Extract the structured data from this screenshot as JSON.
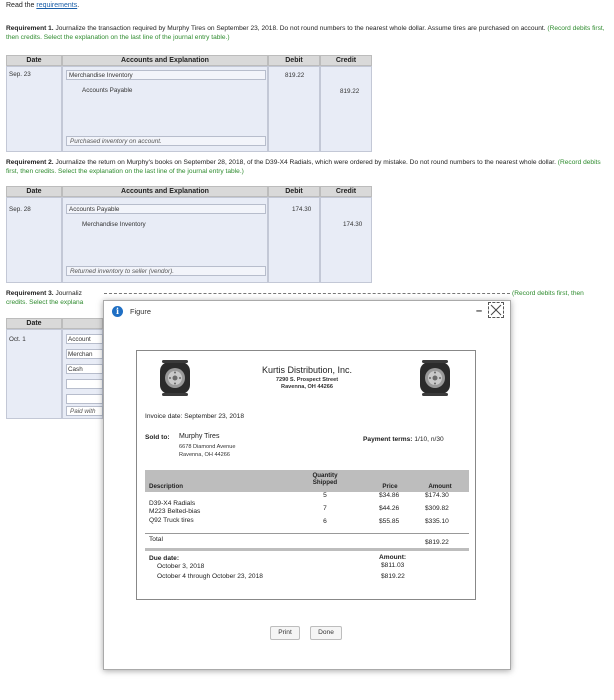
{
  "header": {
    "read_the": "Read the ",
    "requirements_link": "requirements",
    "period": "."
  },
  "req1": {
    "label": "Requirement 1.",
    "text": " Journalize the transaction required by Murphy Tires on September 23, 2018. Do not round numbers to the nearest whole dollar. Assume tires are purchased on account.",
    "hint": "(Record debits first, then credits. Select the explanation on the last line of the journal entry table.)",
    "date": "Sep. 23",
    "line1_account": "Merchandise Inventory",
    "line1_debit": "819.22",
    "line2_account": "Accounts Payable",
    "line2_credit": "819.22",
    "explanation": "Purchased inventory on account."
  },
  "req2": {
    "label": "Requirement 2.",
    "text": " Journalize the return on Murphy's books on September 28, 2018, of the D39-X4 Radials, which were ordered by mistake. Do not round numbers to the nearest whole dollar.",
    "hint": "(Record debits first, then credits. Select the explanation on the last line of the journal entry table.)",
    "date": "Sep. 28",
    "line1_account": "Accounts Payable",
    "line1_debit": "174.30",
    "line2_account": "Merchandise Inventory",
    "line2_credit": "174.30",
    "explanation": "Returned inventory to seller (vendor)."
  },
  "req3": {
    "label": "Requirement 3.",
    "text_visible": " Journaliz",
    "hint_right": "(Record debits first, then",
    "hint_cont": "credits. Select the explana",
    "date": "Oct. 1",
    "acc1": "Account",
    "acc2": "Merchan",
    "acc3": "Cash",
    "explanation": "Paid with"
  },
  "table_headers": {
    "date": "Date",
    "accounts": "Accounts and Explanation",
    "debit": "Debit",
    "credit": "Credit"
  },
  "modal": {
    "info_glyph": "i",
    "title": "Figure",
    "minimize": "–",
    "print_label": "Print",
    "done_label": "Done"
  },
  "invoice": {
    "company": "Kurtis Distribution, Inc.",
    "street": "7290 S. Prospect Street",
    "city": "Ravenna, OH 44266",
    "invoice_date_label": "Invoice date:",
    "invoice_date": "September 23, 2018",
    "sold_to_label": "Sold to:",
    "buyer": "Murphy Tires",
    "buyer_street": "6678 Diamond Avenue",
    "buyer_city": "Ravenna, OH 44266",
    "payment_terms_label": "Payment terms:",
    "payment_terms": "1/10, n/30",
    "col_description": "Description",
    "col_quantity_1": "Quantity",
    "col_quantity_2": "Shipped",
    "col_price": "Price",
    "col_amount": "Amount",
    "items": [
      {
        "description": "D39-X4 Radials",
        "quantity": "5",
        "price": "$34.86",
        "amount": "$174.30"
      },
      {
        "description": "M223 Belted-bias",
        "quantity": "7",
        "price": "$44.26",
        "amount": "$309.82"
      },
      {
        "description": "Q92 Truck tires",
        "quantity": "6",
        "price": "$55.85",
        "amount": "$335.10"
      }
    ],
    "total_label": "Total",
    "total": "$819.22",
    "due_date_label": "Due date:",
    "due_1": "October 3, 2018",
    "due_2": "October 4 through October 23, 2018",
    "amount_label": "Amount:",
    "amount_1": "$811.03",
    "amount_2": "$819.22"
  }
}
